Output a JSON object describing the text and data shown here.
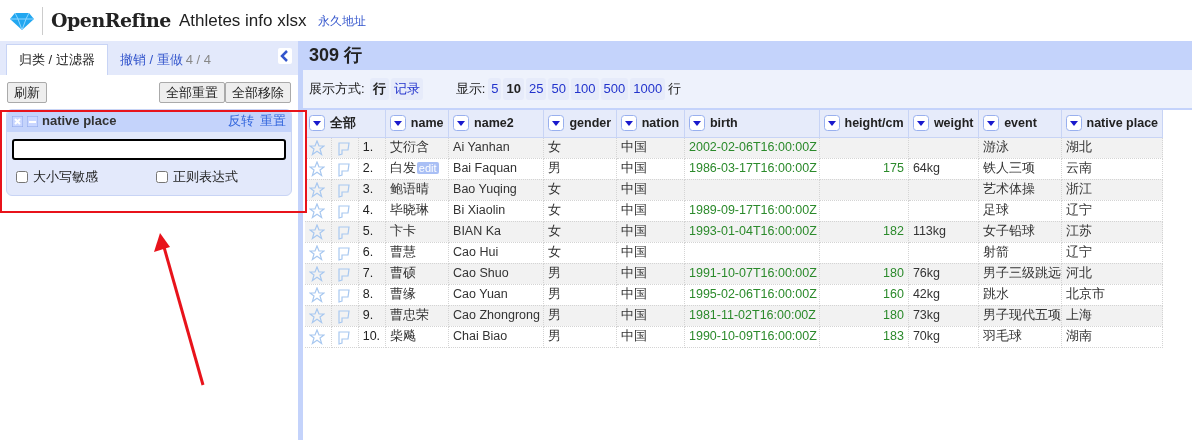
{
  "header": {
    "logo": "OpenRefine",
    "project": "Athletes info xlsx",
    "permalink": "永久地址"
  },
  "left_panel": {
    "tabs": [
      {
        "label": "归类 / 过滤器",
        "selected": true
      },
      {
        "label": "撤销 / 重做",
        "count": "4 / 4",
        "selected": false
      }
    ],
    "buttons_left": [
      "刷新"
    ],
    "buttons_right": [
      "全部重置",
      "全部移除"
    ],
    "facet": {
      "title": "native place",
      "links": [
        "反转",
        "重置"
      ],
      "options": [
        {
          "label": "大小写敏感",
          "checked": false
        },
        {
          "label": "正则表达式",
          "checked": false
        }
      ]
    }
  },
  "grid": {
    "row_count": "309 行",
    "view_label": "展示方式:",
    "view_modes": [
      {
        "label": "行",
        "selected": true
      },
      {
        "label": "记录",
        "selected": false
      }
    ],
    "show_label": "显示:",
    "page_sizes": [
      {
        "label": "5",
        "selected": false
      },
      {
        "label": "10",
        "selected": true
      },
      {
        "label": "25",
        "selected": false
      },
      {
        "label": "50",
        "selected": false
      },
      {
        "label": "100",
        "selected": false
      },
      {
        "label": "500",
        "selected": false
      },
      {
        "label": "1000",
        "selected": false
      }
    ],
    "show_suffix": "行",
    "all_label": "全部",
    "columns": [
      {
        "name": "name",
        "kind": "text"
      },
      {
        "name": "name2",
        "kind": "text"
      },
      {
        "name": "gender",
        "kind": "text"
      },
      {
        "name": "nation",
        "kind": "text"
      },
      {
        "name": "birth",
        "kind": "date"
      },
      {
        "name": "height/cm",
        "kind": "number"
      },
      {
        "name": "weight",
        "kind": "text"
      },
      {
        "name": "event",
        "kind": "text"
      },
      {
        "name": "native place",
        "kind": "text"
      }
    ],
    "rows": [
      {
        "number": "1.",
        "cells": [
          "艾衍含",
          "Ai Yanhan",
          "女",
          "中国",
          "2002-02-06T16:00:00Z",
          null,
          null,
          "游泳",
          "湖北"
        ]
      },
      {
        "number": "2.",
        "cells": [
          "白发",
          "Bai Faquan",
          "男",
          "中国",
          "1986-03-17T16:00:00Z",
          "175",
          "64kg",
          "铁人三项",
          "云南"
        ],
        "edit_badge": "edit"
      },
      {
        "number": "3.",
        "cells": [
          "鲍语晴",
          "Bao Yuqing",
          "女",
          "中国",
          null,
          null,
          null,
          "艺术体操",
          "浙江"
        ]
      },
      {
        "number": "4.",
        "cells": [
          "毕晓琳",
          "Bi Xiaolin",
          "女",
          "中国",
          "1989-09-17T16:00:00Z",
          null,
          null,
          "足球",
          "辽宁"
        ]
      },
      {
        "number": "5.",
        "cells": [
          "卞卡",
          "BIAN Ka",
          "女",
          "中国",
          "1993-01-04T16:00:00Z",
          "182",
          "113kg",
          "女子铅球",
          "江苏"
        ]
      },
      {
        "number": "6.",
        "cells": [
          "曹慧",
          "Cao Hui",
          "女",
          "中国",
          null,
          null,
          null,
          "射箭",
          "辽宁"
        ]
      },
      {
        "number": "7.",
        "cells": [
          "曹硕",
          "Cao Shuo",
          "男",
          "中国",
          "1991-10-07T16:00:00Z",
          "180",
          "76kg",
          "男子三级跳远",
          "河北"
        ]
      },
      {
        "number": "8.",
        "cells": [
          "曹缘",
          "Cao Yuan",
          "男",
          "中国",
          "1995-02-06T16:00:00Z",
          "160",
          "42kg",
          "跳水",
          "北京市"
        ]
      },
      {
        "number": "9.",
        "cells": [
          "曹忠荣",
          "Cao Zhongrong",
          "男",
          "中国",
          "1981-11-02T16:00:00Z",
          "180",
          "73kg",
          "男子现代五项",
          "上海"
        ]
      },
      {
        "number": "10.",
        "cells": [
          "柴飚",
          "Chai Biao",
          "男",
          "中国",
          "1990-10-09T16:00:00Z",
          "183",
          "70kg",
          "羽毛球",
          "湖南"
        ]
      }
    ]
  }
}
